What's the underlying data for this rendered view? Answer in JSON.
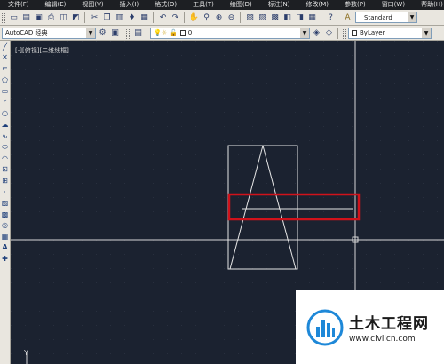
{
  "menu": {
    "items": [
      "文件(F)",
      "编辑(E)",
      "视图(V)",
      "插入(I)",
      "格式(O)",
      "工具(T)",
      "绘图(D)",
      "标注(N)",
      "修改(M)",
      "参数(P)",
      "窗口(W)",
      "帮助(H)"
    ]
  },
  "toolbar": {
    "text_style": "Standard",
    "workspace": "AutoCAD 经典",
    "layer": "0",
    "linetype": "ByLayer"
  },
  "canvas": {
    "viewport_label": "[-][俯视][二维线框]",
    "ucs_axis": "Y"
  },
  "watermark": {
    "title": "土木工程网",
    "url": "www.civilcn.com"
  },
  "colors": {
    "canvas_bg": "#1b2230",
    "menu_bg": "#1d1f23",
    "toolbar_bg": "#e9e6df",
    "highlight": "#d0121b",
    "drawing_lines": "#e6e6e6"
  }
}
